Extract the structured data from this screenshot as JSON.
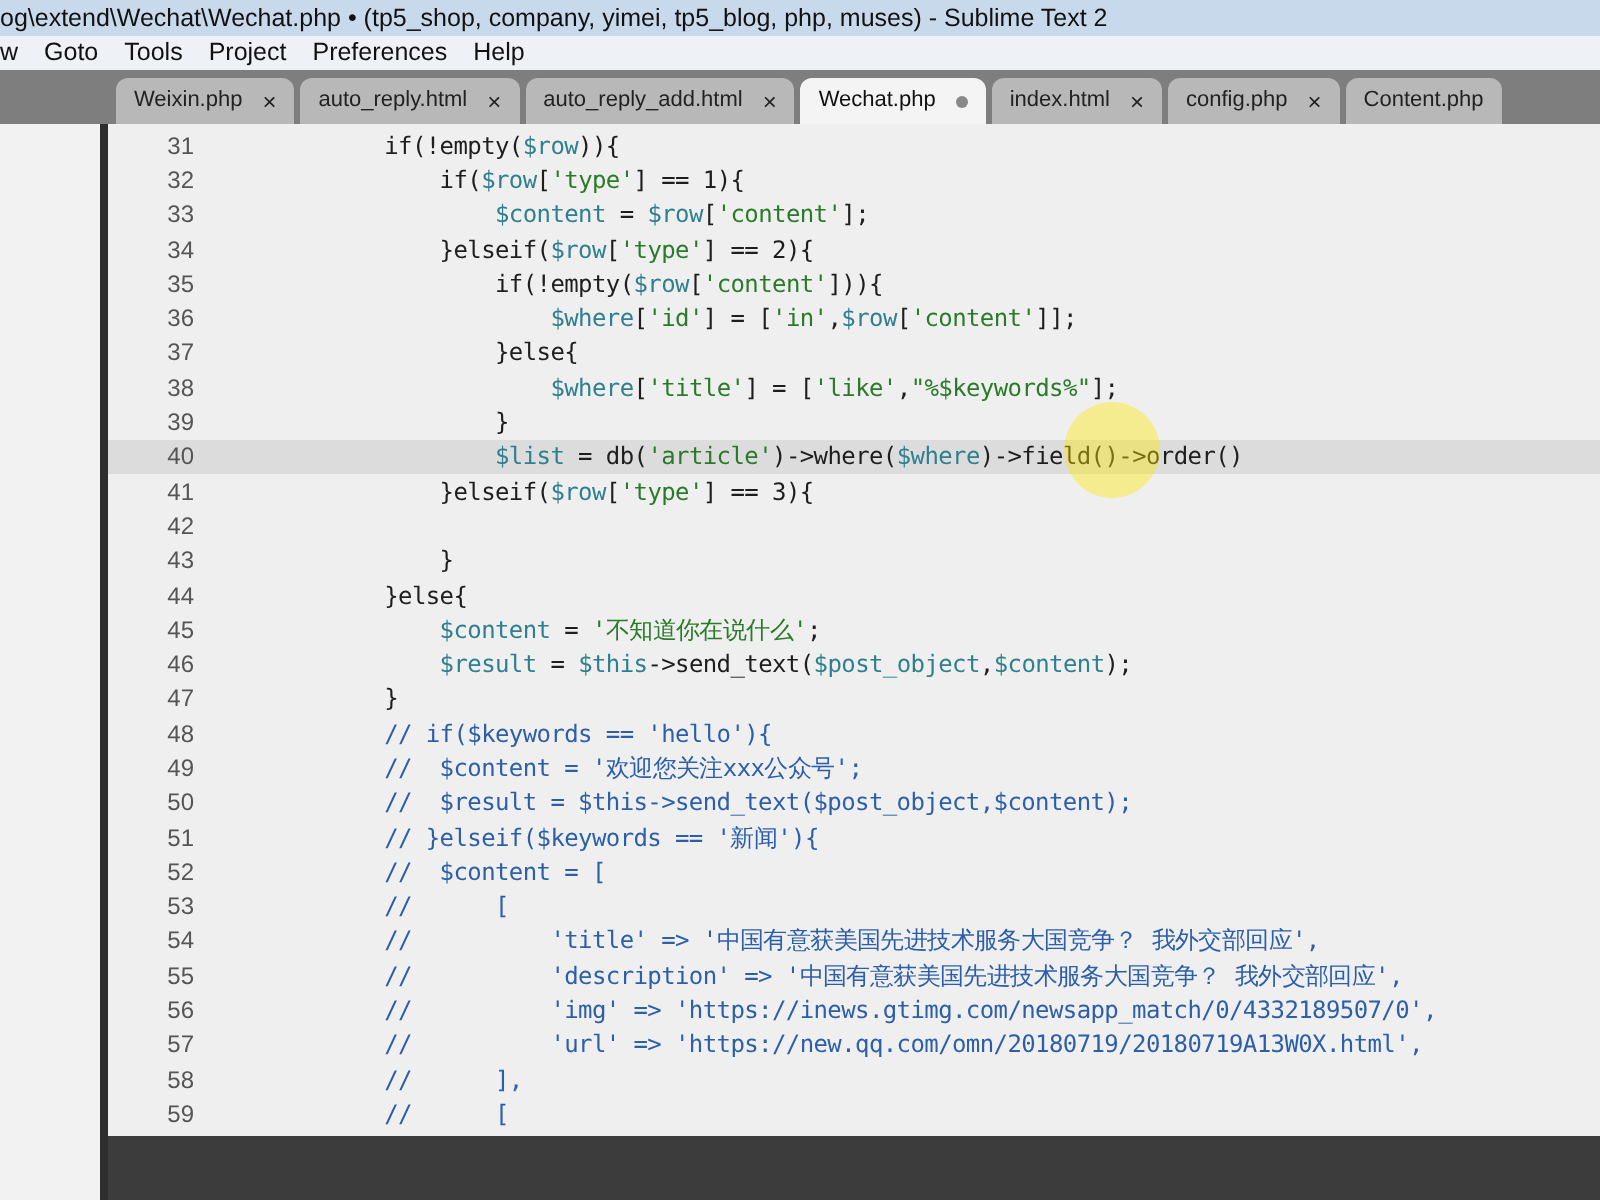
{
  "window": {
    "title": "og\\extend\\Wechat\\Wechat.php • (tp5_shop, company, yimei, tp5_blog, php, muses) - Sublime Text 2"
  },
  "menu": [
    "w",
    "Goto",
    "Tools",
    "Project",
    "Preferences",
    "Help"
  ],
  "tabs": [
    {
      "label": "Weixin.php",
      "selected": false,
      "dirty": false,
      "close": "×"
    },
    {
      "label": "auto_reply.html",
      "selected": false,
      "dirty": false,
      "close": "×"
    },
    {
      "label": "auto_reply_add.html",
      "selected": false,
      "dirty": false,
      "close": "×"
    },
    {
      "label": "Wechat.php",
      "selected": true,
      "dirty": true
    },
    {
      "label": "index.html",
      "selected": false,
      "dirty": false,
      "close": "×"
    },
    {
      "label": "config.php",
      "selected": false,
      "dirty": false,
      "close": "×"
    },
    {
      "label": "Content.php",
      "selected": false,
      "dirty": false
    }
  ],
  "editor": {
    "lines": [
      {
        "number": "31",
        "text": "            if(!empty($row)){",
        "kind": "code",
        "current": false
      },
      {
        "number": "32",
        "text": "                if($row['type'] == 1){",
        "kind": "code",
        "current": false
      },
      {
        "number": "33",
        "text": "                    $content = $row['content'];",
        "kind": "code",
        "current": false
      },
      {
        "number": "34",
        "text": "                }elseif($row['type'] == 2){",
        "kind": "code",
        "current": false
      },
      {
        "number": "35",
        "text": "                    if(!empty($row['content'])){",
        "kind": "code",
        "current": false
      },
      {
        "number": "36",
        "text": "                        $where['id'] = ['in',$row['content']];",
        "kind": "code",
        "current": false
      },
      {
        "number": "37",
        "text": "                    }else{",
        "kind": "code",
        "current": false
      },
      {
        "number": "38",
        "text": "                        $where['title'] = ['like',\"%$keywords%\"];",
        "kind": "code",
        "current": false
      },
      {
        "number": "39",
        "text": "                    }",
        "kind": "code",
        "current": false
      },
      {
        "number": "40",
        "text": "                    $list = db('article')->where($where)->field()->order()",
        "kind": "code",
        "current": true
      },
      {
        "number": "41",
        "text": "                }elseif($row['type'] == 3){",
        "kind": "code",
        "current": false
      },
      {
        "number": "42",
        "kind": "code",
        "current": false
      },
      {
        "number": "43",
        "text": "                }",
        "kind": "code",
        "current": false
      },
      {
        "number": "44",
        "text": "            }else{",
        "kind": "code",
        "current": false
      },
      {
        "number": "45",
        "text": "                $content = '不知道你在说什么';",
        "kind": "code",
        "current": false
      },
      {
        "number": "46",
        "text": "                $result = $this->send_text($post_object,$content);",
        "kind": "code",
        "current": false
      },
      {
        "number": "47",
        "text": "            }",
        "kind": "code",
        "current": false
      },
      {
        "number": "48",
        "text": "            // if($keywords == 'hello'){",
        "kind": "comment",
        "current": false
      },
      {
        "number": "49",
        "text": "            //  $content = '欢迎您关注xxx公众号';",
        "kind": "comment",
        "current": false
      },
      {
        "number": "50",
        "text": "            //  $result = $this->send_text($post_object,$content);",
        "kind": "comment",
        "current": false
      },
      {
        "number": "51",
        "text": "            // }elseif($keywords == '新闻'){",
        "kind": "comment",
        "current": false
      },
      {
        "number": "52",
        "text": "            //  $content = [",
        "kind": "comment",
        "current": false
      },
      {
        "number": "53",
        "text": "            //      [",
        "kind": "comment",
        "current": false
      },
      {
        "number": "54",
        "text": "            //          'title' => '中国有意获美国先进技术服务大国竞争？ 我外交部回应',",
        "kind": "comment",
        "current": false
      },
      {
        "number": "55",
        "text": "            //          'description' => '中国有意获美国先进技术服务大国竞争？ 我外交部回应',",
        "kind": "comment",
        "current": false
      },
      {
        "number": "56",
        "text": "            //          'img' => 'https://inews.gtimg.com/newsapp_match/0/4332189507/0',",
        "kind": "comment",
        "current": false
      },
      {
        "number": "57",
        "text": "            //          'url' => 'https://new.qq.com/omn/20180719/20180719A13W0X.html',",
        "kind": "comment",
        "current": false
      },
      {
        "number": "58",
        "text": "            //      ],",
        "kind": "comment",
        "current": false
      },
      {
        "number": "59",
        "text": "            //      [",
        "kind": "comment",
        "current": false
      }
    ]
  }
}
